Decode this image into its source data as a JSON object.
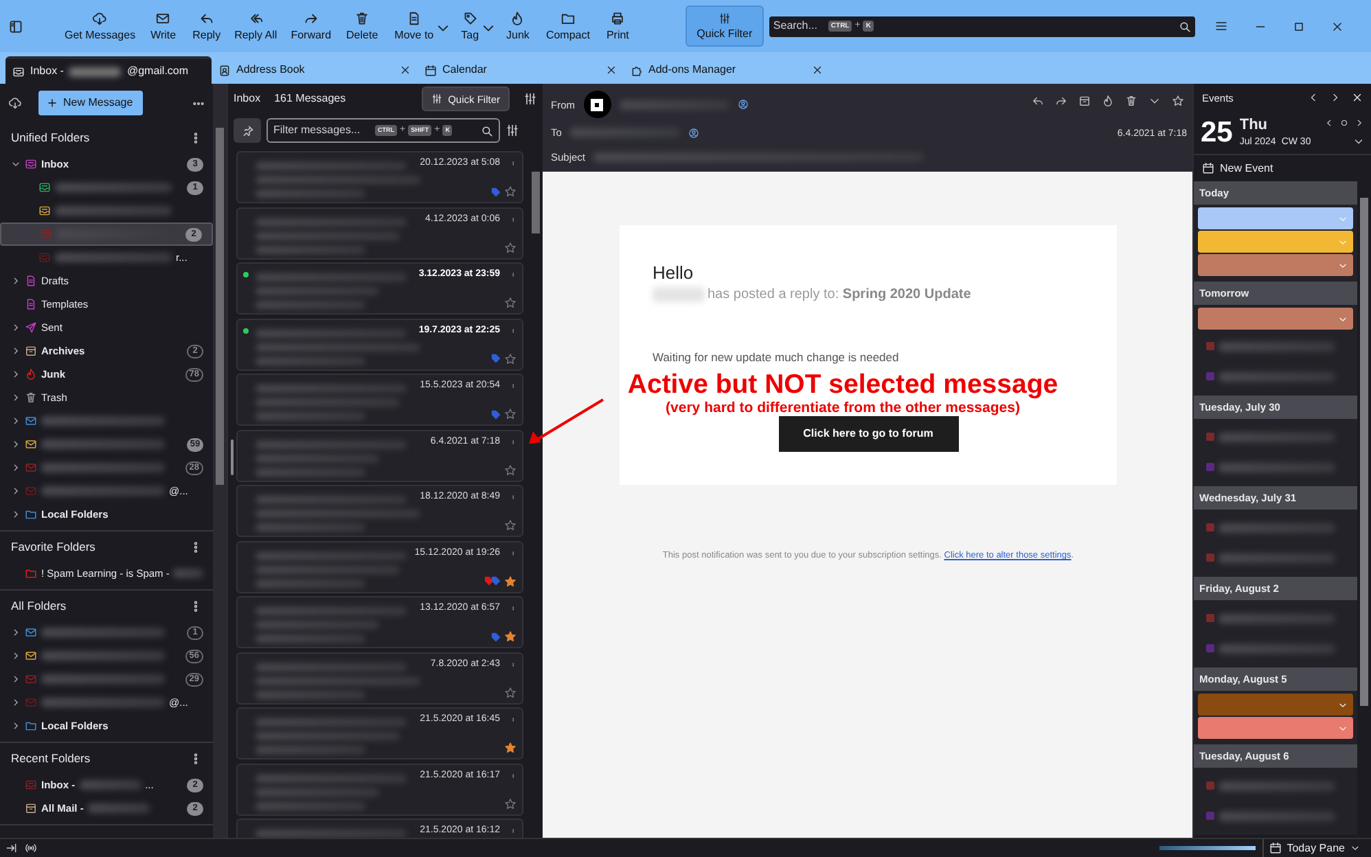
{
  "toolbar": {
    "buttons": [
      {
        "label": "Get Messages"
      },
      {
        "label": "Write"
      },
      {
        "label": "Reply"
      },
      {
        "label": "Reply All"
      },
      {
        "label": "Forward"
      },
      {
        "label": "Delete"
      },
      {
        "label": "Move to",
        "menu": true
      },
      {
        "label": "Tag",
        "menu": true
      },
      {
        "label": "Junk"
      },
      {
        "label": "Compact"
      },
      {
        "label": "Print"
      }
    ],
    "quick_filter": {
      "label": "Quick Filter",
      "selected": true
    },
    "search": {
      "placeholder": "Search...",
      "keys": [
        "CTRL",
        "K"
      ],
      "key_separator": "+"
    }
  },
  "tabs": [
    {
      "label": "Inbox -",
      "redacted": true,
      "label_end": "@gmail.com",
      "selected": true,
      "closable": false
    },
    {
      "label": "Address Book",
      "selected": false,
      "closable": true
    },
    {
      "label": "Calendar",
      "selected": false,
      "closable": true
    },
    {
      "label": "Add-ons Manager",
      "selected": false,
      "closable": true
    }
  ],
  "folder_pane": {
    "new_message": "New Message",
    "sections": [
      {
        "title": "Unified Folders",
        "folders": [
          {
            "kind": "inbox",
            "name": "Inbox",
            "bold": true,
            "color": "#c23fc2",
            "count": "3",
            "expandable": true,
            "expanded": true,
            "children": [
              {
                "kind": "inbox",
                "redacted": true,
                "color": "#27b35a",
                "count": "1"
              },
              {
                "kind": "inbox",
                "redacted": true,
                "color": "#d5a53a"
              },
              {
                "kind": "inbox",
                "redacted": true,
                "color": "#8c2222",
                "count": "2",
                "selected": true
              },
              {
                "kind": "inbox",
                "redacted": true,
                "color": "#6e1a1a",
                "name_end": "r..."
              }
            ]
          },
          {
            "kind": "drafts",
            "name": "Drafts",
            "color": "#c23fc2",
            "expandable": true
          },
          {
            "kind": "templates",
            "name": "Templates",
            "color": "#c23fc2"
          },
          {
            "kind": "sent",
            "name": "Sent",
            "color": "#c23fc2",
            "expandable": true
          },
          {
            "kind": "archive",
            "name": "Archives",
            "bold": true,
            "color": "#c9ad85",
            "count": "2",
            "outlined": true,
            "expandable": true
          },
          {
            "kind": "junk",
            "name": "Junk",
            "bold": true,
            "color": "#e02020",
            "count": "78",
            "outlined": true,
            "expandable": true
          },
          {
            "kind": "trash",
            "name": "Trash",
            "color": "#9a9aa0",
            "expandable": true
          },
          {
            "kind": "account",
            "redacted": true,
            "color": "#3d8fd8",
            "expandable": true
          },
          {
            "kind": "account",
            "redacted": true,
            "color": "#d5a53a",
            "count": "59",
            "expandable": true
          },
          {
            "kind": "account",
            "redacted": true,
            "color": "#8c2222",
            "count": "28",
            "outlined": true,
            "expandable": true
          },
          {
            "kind": "account",
            "redacted": true,
            "color": "#6e1a1a",
            "name_end": "@...",
            "expandable": true
          },
          {
            "kind": "folder",
            "name": "Local Folders",
            "bold": true,
            "color": "#3d8fd8",
            "expandable": true
          }
        ]
      },
      {
        "title": "Favorite Folders",
        "folders": [
          {
            "kind": "folder",
            "name": "! Spam Learning - is Spam -",
            "redacted": true,
            "color": "#e02020"
          }
        ]
      },
      {
        "title": "All Folders",
        "folders": [
          {
            "kind": "account",
            "redacted": true,
            "color": "#3d8fd8",
            "count": "1",
            "outlined": true,
            "expandable": true
          },
          {
            "kind": "account",
            "redacted": true,
            "color": "#d5a53a",
            "count": "56",
            "outlined": true,
            "expandable": true
          },
          {
            "kind": "account",
            "redacted": true,
            "color": "#8c2222",
            "count": "29",
            "outlined": true,
            "expandable": true
          },
          {
            "kind": "account",
            "redacted": true,
            "color": "#6e1a1a",
            "name_end": "@...",
            "expandable": true
          },
          {
            "kind": "folder",
            "name": "Local Folders",
            "bold": true,
            "color": "#3d8fd8",
            "expandable": true
          }
        ]
      },
      {
        "title": "Recent Folders",
        "folders": [
          {
            "kind": "inbox",
            "name": "Inbox -",
            "bold": true,
            "redacted": true,
            "name_end": "...",
            "color": "#8c2222",
            "count": "2"
          },
          {
            "kind": "archive",
            "name": "All Mail -",
            "bold": true,
            "redacted": true,
            "color": "#c9ad85",
            "count": "2"
          }
        ]
      }
    ]
  },
  "message_list": {
    "folder": "Inbox",
    "count": "161 Messages",
    "quick_filter": {
      "label": "Quick Filter",
      "selected": true
    },
    "filter": {
      "placeholder": "Filter messages...",
      "keys": [
        "CTRL",
        "SHIFT",
        "K"
      ],
      "key_separator": "+"
    },
    "messages": [
      {
        "date": "20.12.2023 at 5:08",
        "unread": false,
        "starred": false,
        "active": false,
        "tags": [
          {
            "color": "#2f5fd8"
          }
        ]
      },
      {
        "date": "4.12.2023 at 0:06",
        "unread": false,
        "starred": false,
        "active": false
      },
      {
        "date": "3.12.2023 at 23:59",
        "unread": true,
        "starred": false,
        "active": false
      },
      {
        "date": "19.7.2023 at 22:25",
        "unread": true,
        "starred": false,
        "active": false,
        "tags": [
          {
            "color": "#2f5fd8"
          }
        ]
      },
      {
        "date": "15.5.2023 at 20:54",
        "unread": false,
        "starred": false,
        "active": false,
        "tags": [
          {
            "color": "#2f5fd8"
          }
        ]
      },
      {
        "date": "6.4.2021 at 7:18",
        "unread": false,
        "starred": false,
        "active": true
      },
      {
        "date": "18.12.2020 at 8:49",
        "unread": false,
        "starred": false,
        "active": false
      },
      {
        "date": "15.12.2020 at 19:26",
        "unread": false,
        "starred": true,
        "active": false,
        "tags": [
          {
            "color": "#d81b1b"
          },
          {
            "color": "#2f5fd8"
          }
        ]
      },
      {
        "date": "13.12.2020 at 6:57",
        "unread": false,
        "starred": true,
        "active": false,
        "tags": [
          {
            "color": "#2f5fd8"
          }
        ]
      },
      {
        "date": "7.8.2020 at 2:43",
        "unread": false,
        "starred": false,
        "active": false
      },
      {
        "date": "21.5.2020 at 16:45",
        "unread": false,
        "starred": true,
        "active": false
      },
      {
        "date": "21.5.2020 at 16:17",
        "unread": false,
        "starred": false,
        "active": false
      },
      {
        "date": "21.5.2020 at 16:12",
        "unread": false,
        "active": false
      }
    ]
  },
  "reader": {
    "from_label": "From",
    "to_label": "To",
    "subject_label": "Subject",
    "date": "6.4.2021 at 7:18",
    "body": {
      "greeting": "Hello",
      "reply_line": "has posted a reply to: **Spring 2020 Update**",
      "message": "Waiting for new update much change is needed",
      "button": "Click here to go to forum",
      "footer": "This post notification was sent to you due to your subscription settings.",
      "footer_link": "Click here to alter those settings",
      "footer_end": "."
    }
  },
  "annotation": {
    "title": "Active but NOT selected message",
    "subtitle": "(very hard to differentiate from the other messages)"
  },
  "today_pane": {
    "title": "Events",
    "day": "25",
    "weekday": "Thu",
    "month": "Jul 2024",
    "week": "CW 30",
    "new_event": "New Event",
    "days": [
      {
        "label": "Today",
        "events": [
          {
            "kind": "bar",
            "color": "#a9c8f8"
          },
          {
            "kind": "bar",
            "color": "#f2b833"
          },
          {
            "kind": "bar",
            "color": "#c07a62"
          }
        ]
      },
      {
        "label": "Tomorrow",
        "events": [
          {
            "kind": "bar",
            "color": "#c07a62"
          },
          {
            "kind": "row",
            "color": "#7a2a2a"
          },
          {
            "kind": "row",
            "color": "#5a2a80"
          }
        ]
      },
      {
        "label": "Tuesday, July 30",
        "events": [
          {
            "kind": "row",
            "color": "#7a2a2a"
          },
          {
            "kind": "row",
            "color": "#5a2a80"
          }
        ]
      },
      {
        "label": "Wednesday, July 31",
        "events": [
          {
            "kind": "row",
            "color": "#7a2a2a"
          },
          {
            "kind": "row",
            "color": "#7a2a2a"
          }
        ]
      },
      {
        "label": "Friday, August 2",
        "events": [
          {
            "kind": "row",
            "color": "#7a2a2a"
          },
          {
            "kind": "row",
            "color": "#5a2a80"
          }
        ]
      },
      {
        "label": "Monday, August 5",
        "events": [
          {
            "kind": "bar",
            "color": "#8a4a10"
          },
          {
            "kind": "bar",
            "color": "#e87a70"
          }
        ]
      },
      {
        "label": "Tuesday, August 6",
        "events": [
          {
            "kind": "row",
            "color": "#7a2a2a"
          },
          {
            "kind": "row",
            "color": "#5a2a80"
          }
        ]
      }
    ]
  },
  "status_bar": {
    "activity": {
      "level": 1
    },
    "today_pane": "Today Pane"
  }
}
